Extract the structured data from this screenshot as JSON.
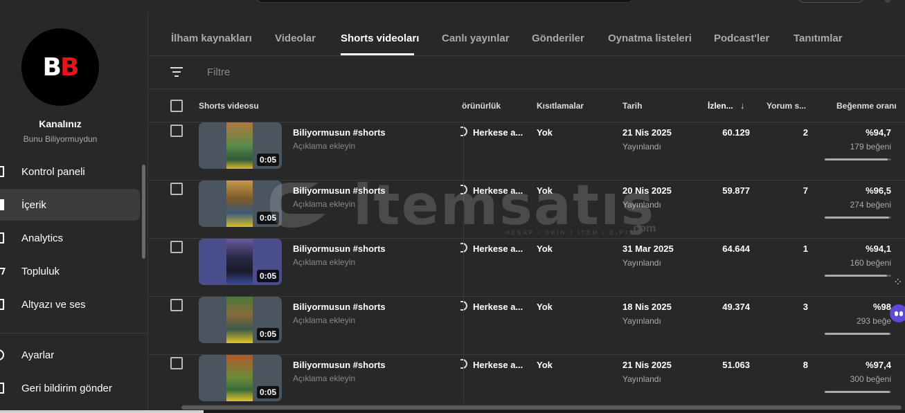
{
  "channel": {
    "title": "Kanalınız",
    "name": "Bunu Biliyormuydun",
    "avatar_text": "BB"
  },
  "sidebar": {
    "items": [
      {
        "label": "Kontrol paneli",
        "icon": "dashboard-icon"
      },
      {
        "label": "İçerik",
        "icon": "content-icon",
        "active": true
      },
      {
        "label": "Analytics",
        "icon": "analytics-icon"
      },
      {
        "label": "Topluluk",
        "icon": "community-icon"
      },
      {
        "label": "Altyazı ve ses",
        "icon": "subtitles-icon"
      }
    ],
    "bottom_items": [
      {
        "label": "Ayarlar",
        "icon": "settings-icon"
      },
      {
        "label": "Geri bildirim gönder",
        "icon": "feedback-icon"
      }
    ]
  },
  "tabs": [
    "İlham kaynakları",
    "Videolar",
    "Shorts videoları",
    "Canlı yayınlar",
    "Gönderiler",
    "Oynatma listeleri",
    "Podcast'ler",
    "Tanıtımlar"
  ],
  "active_tab": "Shorts videoları",
  "filter": {
    "placeholder": "Filtre"
  },
  "table": {
    "headers": {
      "video": "Shorts videosu",
      "visibility": "örünürlük",
      "restrictions": "Kısıtlamalar",
      "date": "Tarih",
      "views": "İzlen...",
      "comments": "Yorum s...",
      "likes": "Beğenme oranı"
    },
    "rows": [
      {
        "title": "Biliyormusun #shorts",
        "desc": "Açıklama ekleyin",
        "duration": "0:05",
        "visibility": "Herkese a...",
        "restriction": "Yok",
        "date": "21 Nis 2025",
        "status": "Yayınlandı",
        "views": "60.129",
        "comments": "2",
        "like_pct": "%94,7",
        "like_count": "179 beğeni",
        "like_ratio": 0.947
      },
      {
        "title": "Biliyormusun #shorts",
        "desc": "Açıklama ekleyin",
        "duration": "0:05",
        "visibility": "Herkese a...",
        "restriction": "Yok",
        "date": "20 Nis 2025",
        "status": "Yayınlandı",
        "views": "59.877",
        "comments": "7",
        "like_pct": "%96,5",
        "like_count": "274 beğeni",
        "like_ratio": 0.965
      },
      {
        "title": "Biliyormusun #shorts",
        "desc": "Açıklama ekleyin",
        "duration": "0:05",
        "visibility": "Herkese a...",
        "restriction": "Yok",
        "date": "31 Mar 2025",
        "status": "Yayınlandı",
        "views": "64.644",
        "comments": "1",
        "like_pct": "%94,1",
        "like_count": "160 beğeni",
        "like_ratio": 0.941
      },
      {
        "title": "Biliyormusun #shorts",
        "desc": "Açıklama ekleyin",
        "duration": "0:05",
        "visibility": "Herkese a...",
        "restriction": "Yok",
        "date": "18 Nis 2025",
        "status": "Yayınlandı",
        "views": "49.374",
        "comments": "3",
        "like_pct": "%98",
        "like_count": "293 beğe",
        "like_ratio": 0.98
      },
      {
        "title": "Biliyormusun #shorts",
        "desc": "Açıklama ekleyin",
        "duration": "0:05",
        "visibility": "Herkese a...",
        "restriction": "Yok",
        "date": "21 Nis 2025",
        "status": "Yayınlandı",
        "views": "51.063",
        "comments": "8",
        "like_pct": "%97,4",
        "like_count": "300 beğeni",
        "like_ratio": 0.974
      }
    ]
  },
  "watermark": {
    "text": "itemsatış",
    "domain": ".com",
    "tagline": "HESAP / SKIN / ITEM / E-PIN"
  },
  "colors": {
    "background": "#282828",
    "accent_red": "#e8141c",
    "text_secondary": "#aaaaaa"
  }
}
